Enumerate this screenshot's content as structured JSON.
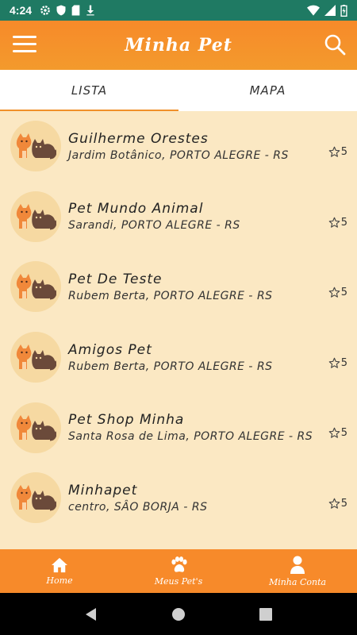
{
  "status_bar": {
    "time": "4:24"
  },
  "app": {
    "title": "Minha Pet"
  },
  "tabs": [
    {
      "label": "LISTA",
      "active": true
    },
    {
      "label": "MAPA",
      "active": false
    }
  ],
  "list": [
    {
      "name": "Guilherme Orestes",
      "address": "Jardim Botânico, PORTO ALEGRE - RS",
      "rating": "5"
    },
    {
      "name": "Pet Mundo Animal",
      "address": "Sarandi, PORTO ALEGRE - RS",
      "rating": "5"
    },
    {
      "name": "Pet De Teste",
      "address": "Rubem Berta, PORTO ALEGRE - RS",
      "rating": "5"
    },
    {
      "name": "Amigos Pet",
      "address": "Rubem Berta, PORTO ALEGRE - RS",
      "rating": "5"
    },
    {
      "name": "Pet Shop Minha",
      "address": "Santa Rosa de Lima, PORTO ALEGRE - RS",
      "rating": "5"
    },
    {
      "name": "Minhapet",
      "address": "centro, SÂO BORJA - RS",
      "rating": "5"
    }
  ],
  "bottom_nav": [
    {
      "label": "Home",
      "icon": "home-icon"
    },
    {
      "label": "Meus Pet's",
      "icon": "paw-icon"
    },
    {
      "label": "Minha Conta",
      "icon": "user-icon"
    }
  ],
  "colors": {
    "primary": "#f78a2a",
    "status_bar": "#1f7a63",
    "background": "#fbe8c3"
  }
}
